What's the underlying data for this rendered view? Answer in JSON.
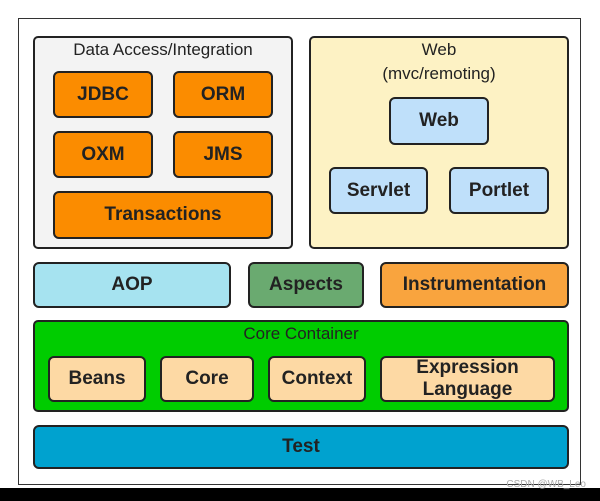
{
  "data_access": {
    "title": "Data Access/Integration",
    "modules": [
      "JDBC",
      "ORM",
      "OXM",
      "JMS",
      "Transactions"
    ]
  },
  "web": {
    "title": "Web",
    "subtitle": "(mvc/remoting)",
    "modules": [
      "Web",
      "Servlet",
      "Portlet"
    ]
  },
  "middle": {
    "aop": "AOP",
    "aspects": "Aspects",
    "instrumentation": "Instrumentation"
  },
  "core_container": {
    "title": "Core Container",
    "modules": [
      "Beans",
      "Core",
      "Context",
      "Expression Language"
    ]
  },
  "test": "Test",
  "watermark": "CSDN @WB_Leo",
  "colors": {
    "orange": "#fb8c00",
    "web_bg": "#fdf2c4",
    "light_blue": "#bfe0fa",
    "aop": "#a6e3f0",
    "aspects": "#6aaa70",
    "instrumentation": "#f9a43e",
    "core_green": "#00cc00",
    "peach": "#fdd9a4",
    "test": "#00a2cf"
  }
}
